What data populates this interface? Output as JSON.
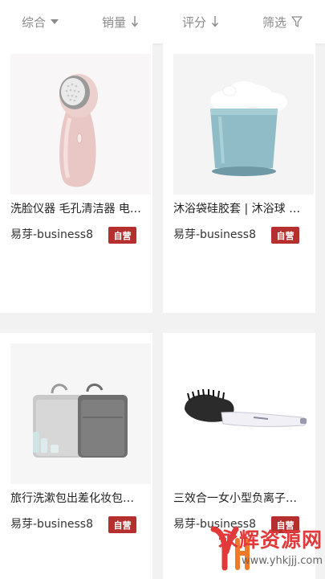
{
  "sort_bar": {
    "composite": "综合",
    "sales": "销量",
    "rating": "评分",
    "filter": "筛选"
  },
  "products": [
    {
      "name": "洗脸仪器 毛孔清洁器 电…",
      "shop": "易芽-business8",
      "badge": "自营",
      "image": "facial-cleansing-brush"
    },
    {
      "name": "沐浴袋硅胶套 | 沐浴球 …",
      "shop": "易芽-business8",
      "badge": "自营",
      "image": "bath-sponge-cup"
    },
    {
      "name": "旅行洗漱包出差化妆包…",
      "shop": "易芽-business8",
      "badge": "自营",
      "image": "travel-toiletry-bag"
    },
    {
      "name": "三效合一女小型负离子…",
      "shop": "易芽-business8",
      "badge": "自营",
      "image": "hair-straightening-brush"
    }
  ],
  "watermark": {
    "text": "永辉资源网",
    "url": "www.yhkjjj.com"
  },
  "colors": {
    "badge": "#b52f2f",
    "watermark": "#e23a3a"
  }
}
